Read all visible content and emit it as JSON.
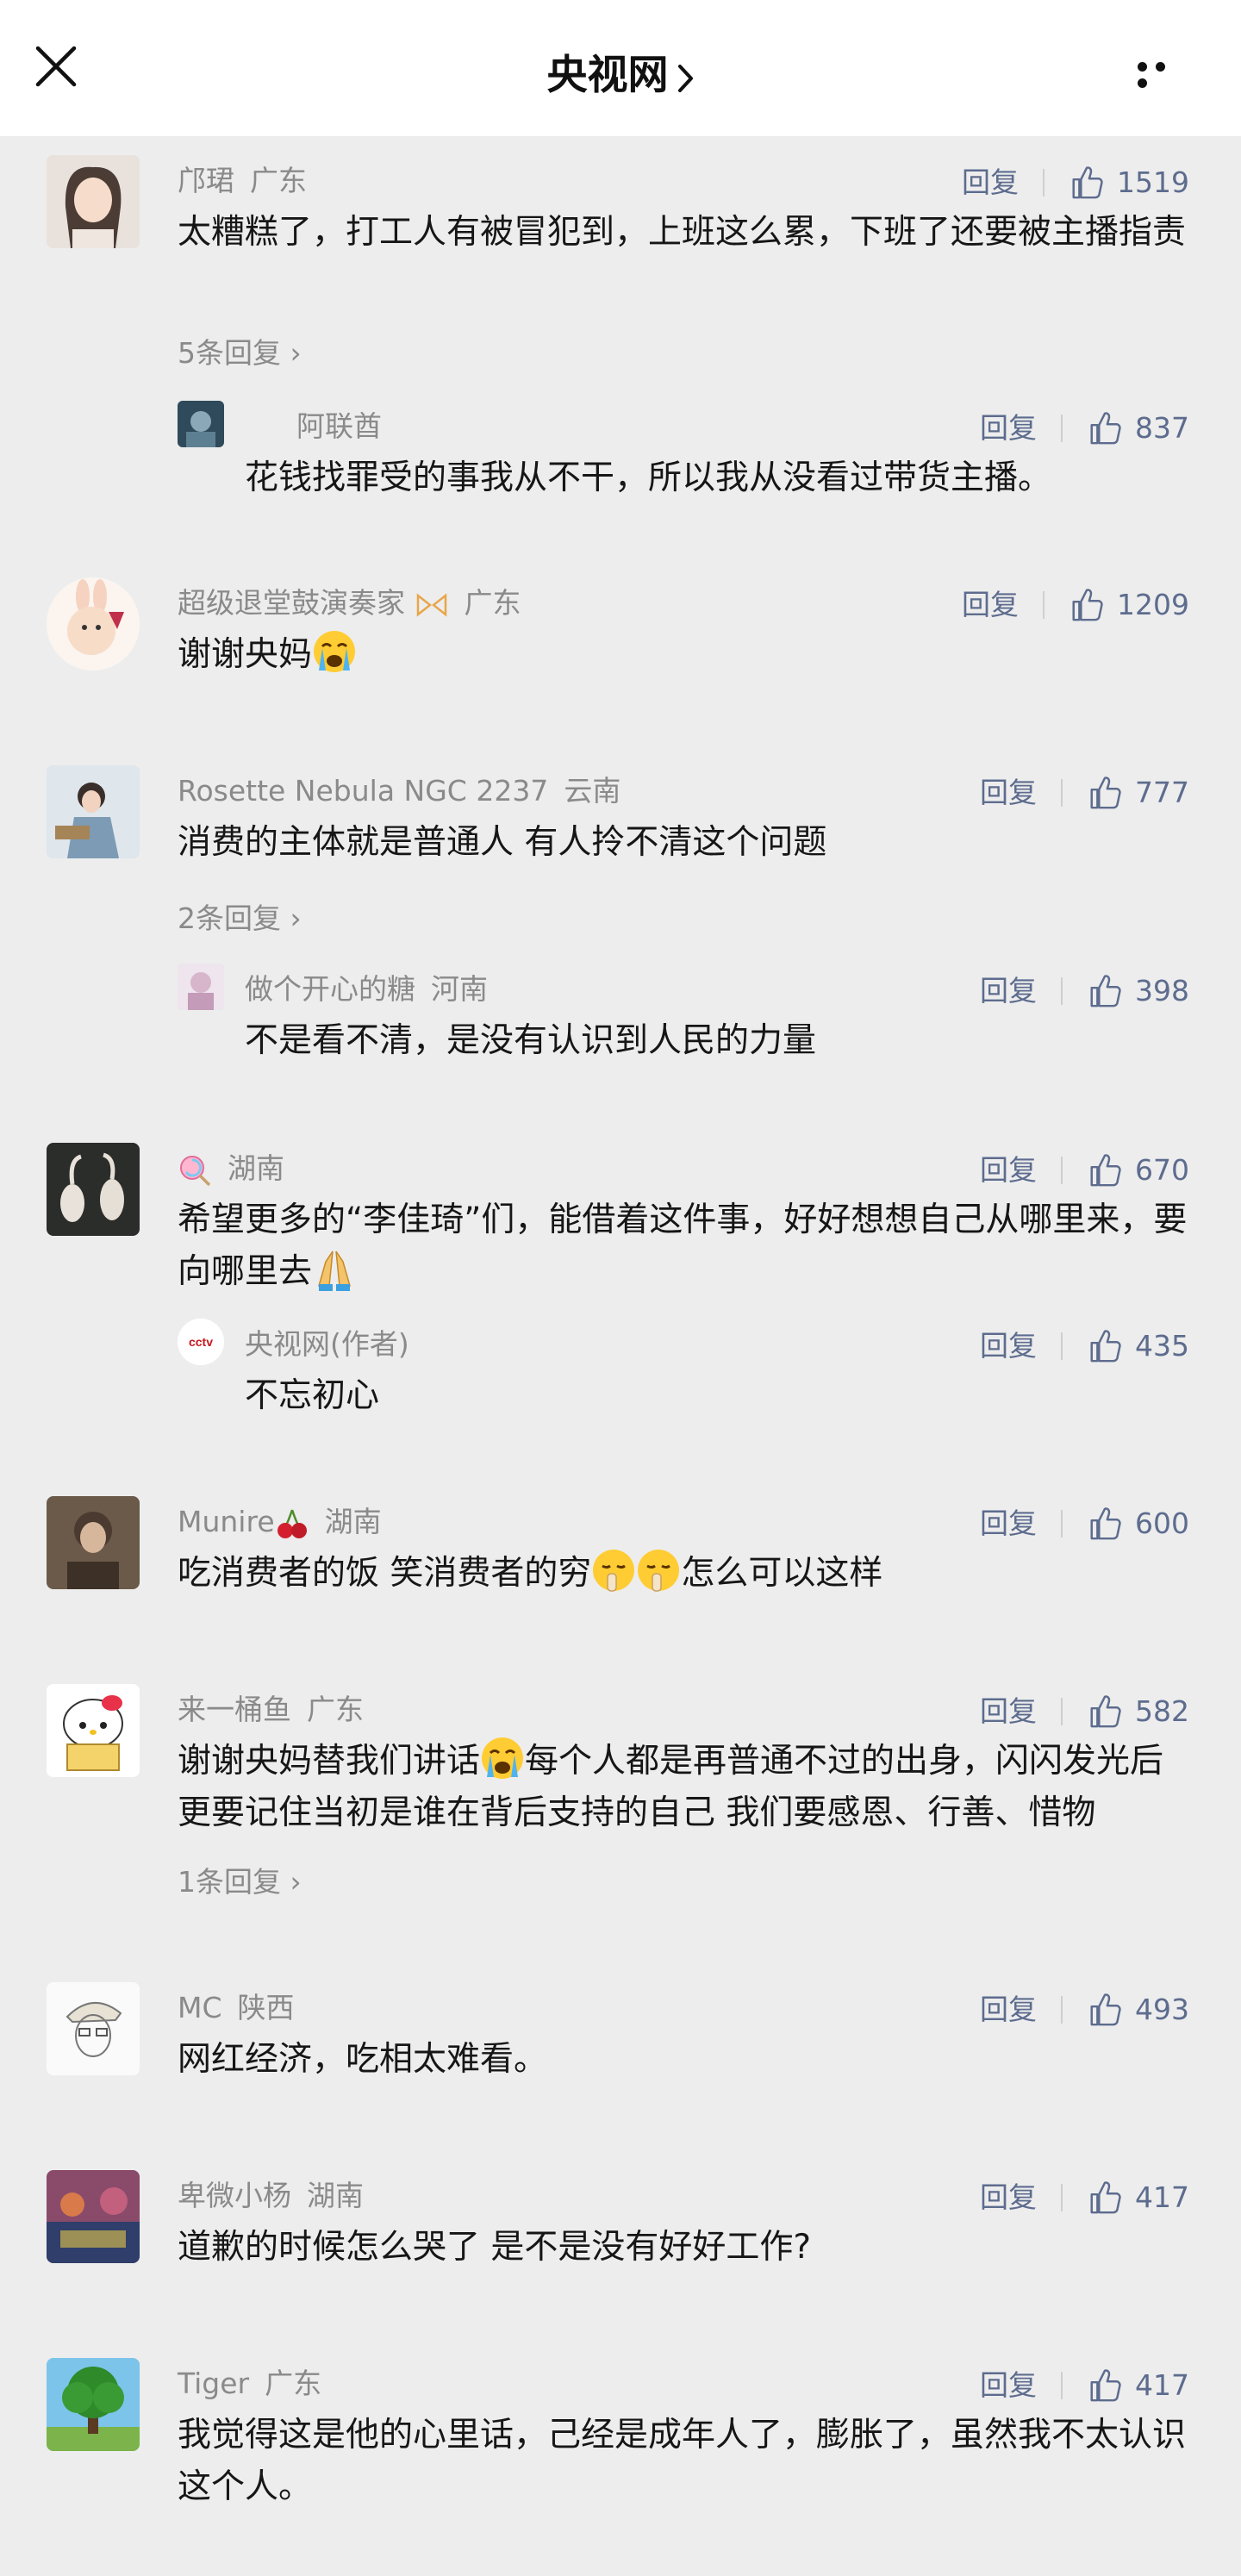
{
  "header": {
    "title": "央视网"
  },
  "actions": {
    "reply_label": "回复"
  },
  "comments": [
    {
      "name": "邝珺",
      "location": "广东",
      "likes": "1519",
      "text": "太糟糕了，打工人有被冒犯到，上班这么累，下班了还要被主播指责",
      "more_replies": "5条回复",
      "reply": {
        "name": "阿联酋",
        "location": "",
        "likes": "837",
        "text": "花钱找罪受的事我从不干，所以我从没看过带货主播。"
      }
    },
    {
      "name": "超级退堂鼓演奏家",
      "location": "广东",
      "likes": "1209",
      "text": "谢谢央妈"
    },
    {
      "name": "Rosette Nebula NGC 2237",
      "location": "云南",
      "likes": "777",
      "text": "消费的主体就是普通人 有人拎不清这个问题",
      "more_replies": "2条回复",
      "reply": {
        "name": "做个开心的糖",
        "location": "河南",
        "likes": "398",
        "text": "不是看不清，是没有认识到人民的力量"
      }
    },
    {
      "name": "",
      "location": "湖南",
      "likes": "670",
      "text": "希望更多的“李佳琦”们，能借着这件事，好好想想自己从哪里来，要向哪里去",
      "reply": {
        "name": "央视网(作者)",
        "location": "",
        "likes": "435",
        "text": "不忘初心"
      }
    },
    {
      "name": "Munire",
      "location": "湖南",
      "likes": "600",
      "text_a": "吃消费者的饭 笑消费者的穷",
      "text_b": "怎么可以这样"
    },
    {
      "name": "来一桶鱼",
      "location": "广东",
      "likes": "582",
      "text_a": "谢谢央妈替我们讲话",
      "text_b": "每个人都是再普通不过的出身，闪闪发光后更要记住当初是谁在背后支持的自己 我们要感恩、行善、惜物",
      "more_replies": "1条回复"
    },
    {
      "name": "MC",
      "location": "陕西",
      "likes": "493",
      "text": "网红经济，吃相太难看。"
    },
    {
      "name": "卑微小杨",
      "location": "湖南",
      "likes": "417",
      "text": "道歉的时候怎么哭了 是不是没有好好工作?"
    },
    {
      "name": "Tiger",
      "location": "广东",
      "likes": "417",
      "text": "我觉得这是他的心里话，己经是成年人了，膨胀了，虽然我不太认识这个人。"
    }
  ]
}
